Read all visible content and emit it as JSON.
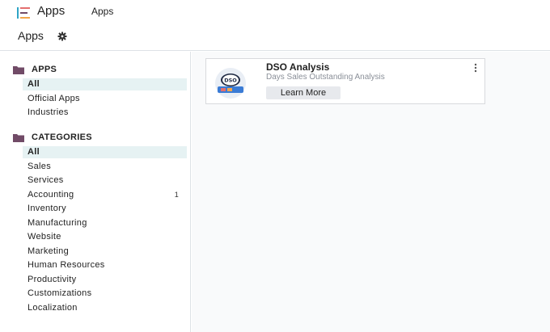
{
  "navbar": {
    "app_name": "Apps",
    "menu_item": "Apps"
  },
  "control_panel": {
    "title": "Apps"
  },
  "sidebar": {
    "apps_header": "APPS",
    "apps_items": [
      {
        "label": "All",
        "active": true
      },
      {
        "label": "Official Apps"
      },
      {
        "label": "Industries"
      }
    ],
    "categories_header": "CATEGORIES",
    "category_items": [
      {
        "label": "All",
        "active": true
      },
      {
        "label": "Sales"
      },
      {
        "label": "Services"
      },
      {
        "label": "Accounting",
        "count": "1"
      },
      {
        "label": "Inventory"
      },
      {
        "label": "Manufacturing"
      },
      {
        "label": "Website"
      },
      {
        "label": "Marketing"
      },
      {
        "label": "Human Resources"
      },
      {
        "label": "Productivity"
      },
      {
        "label": "Customizations"
      },
      {
        "label": "Localization"
      }
    ]
  },
  "card": {
    "title": "DSO Analysis",
    "subtitle": "Days Sales Outstanding Analysis",
    "button": "Learn More",
    "icon_text": "DSO"
  },
  "colors": {
    "accent": "#714b67",
    "active_bg": "#e6f2f3",
    "content_bg": "#f9fafb"
  }
}
